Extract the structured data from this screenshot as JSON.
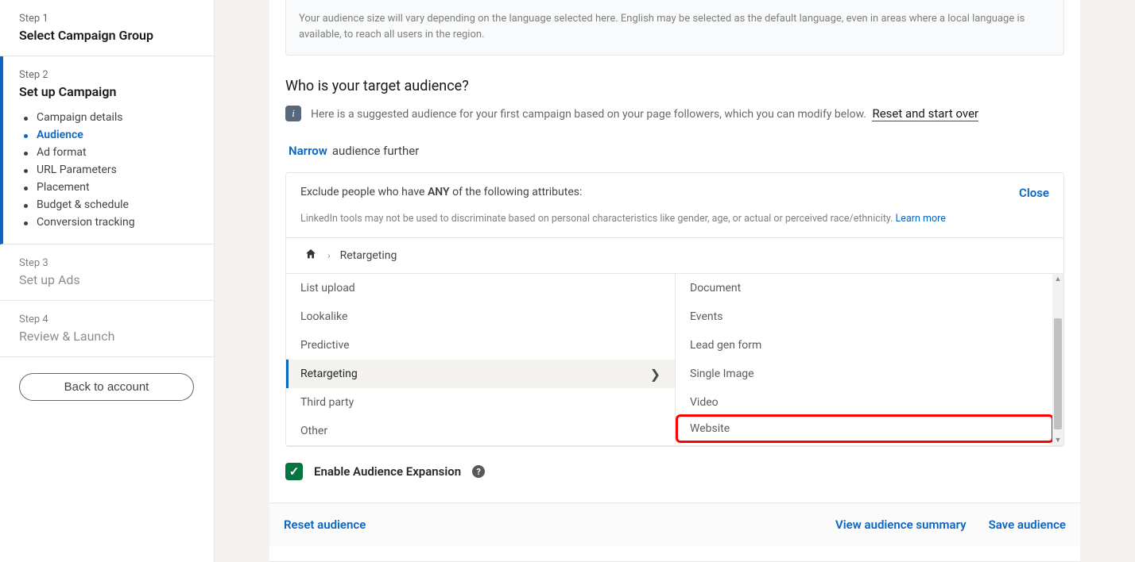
{
  "sidebar": {
    "step1": {
      "label": "Step 1",
      "title": "Select Campaign Group"
    },
    "step2": {
      "label": "Step 2",
      "title": "Set up Campaign",
      "items": [
        "Campaign details",
        "Audience",
        "Ad format",
        "URL Parameters",
        "Placement",
        "Budget & schedule",
        "Conversion tracking"
      ],
      "active_index": 1
    },
    "step3": {
      "label": "Step 3",
      "title": "Set up Ads"
    },
    "step4": {
      "label": "Step 4",
      "title": "Review & Launch"
    },
    "back_button": "Back to account"
  },
  "language_note": "Your audience size will vary depending on the language selected here. English may be selected as the default language, even in areas where a local language is available, to reach all users in the region.",
  "audience": {
    "heading": "Who is your target audience?",
    "info_text": "Here is a suggested audience for your first campaign based on your page followers, which you can modify below.",
    "reset_over": "Reset and start over",
    "narrow_link": "Narrow",
    "narrow_rest": "audience further"
  },
  "exclude": {
    "header_pre": "Exclude people who have ",
    "header_bold": "ANY",
    "header_post": " of the following attributes:",
    "close": "Close",
    "disclaimer": "LinkedIn tools may not be used to discriminate based on personal characteristics like gender, age, or actual or perceived race/ethnicity. ",
    "learn_more": "Learn more",
    "breadcrumb": "Retargeting",
    "left_items": [
      "List upload",
      "Lookalike",
      "Predictive",
      "Retargeting",
      "Third party",
      "Other"
    ],
    "left_selected_index": 3,
    "right_items": [
      "Document",
      "Events",
      "Lead gen form",
      "Single Image",
      "Video",
      "Website"
    ],
    "right_highlight_index": 5
  },
  "expansion": {
    "label": "Enable Audience Expansion",
    "checked": true
  },
  "footer": {
    "reset": "Reset audience",
    "summary": "View audience summary",
    "save": "Save audience"
  }
}
